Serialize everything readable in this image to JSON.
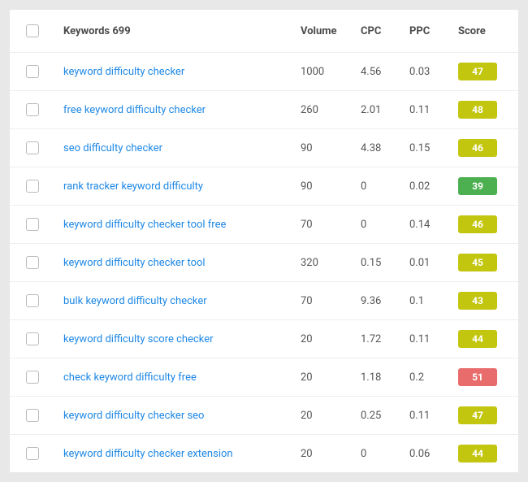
{
  "table": {
    "headers": {
      "keywords_label": "Keywords 699",
      "volume": "Volume",
      "cpc": "CPC",
      "ppc": "PPC",
      "score": "Score"
    },
    "rows": [
      {
        "keyword": "keyword difficulty checker",
        "volume": "1000",
        "cpc": "4.56",
        "ppc": "0.03",
        "score": "47",
        "score_class": "score-yellow"
      },
      {
        "keyword": "free keyword difficulty checker",
        "volume": "260",
        "cpc": "2.01",
        "ppc": "0.11",
        "score": "48",
        "score_class": "score-yellow"
      },
      {
        "keyword": "seo difficulty checker",
        "volume": "90",
        "cpc": "4.38",
        "ppc": "0.15",
        "score": "46",
        "score_class": "score-yellow"
      },
      {
        "keyword": "rank tracker keyword difficulty",
        "volume": "90",
        "cpc": "0",
        "ppc": "0.02",
        "score": "39",
        "score_class": "score-green"
      },
      {
        "keyword": "keyword difficulty checker tool free",
        "volume": "70",
        "cpc": "0",
        "ppc": "0.14",
        "score": "46",
        "score_class": "score-yellow"
      },
      {
        "keyword": "keyword difficulty checker tool",
        "volume": "320",
        "cpc": "0.15",
        "ppc": "0.01",
        "score": "45",
        "score_class": "score-yellow"
      },
      {
        "keyword": "bulk keyword difficulty checker",
        "volume": "70",
        "cpc": "9.36",
        "ppc": "0.1",
        "score": "43",
        "score_class": "score-yellow"
      },
      {
        "keyword": "keyword difficulty score checker",
        "volume": "20",
        "cpc": "1.72",
        "ppc": "0.11",
        "score": "44",
        "score_class": "score-yellow"
      },
      {
        "keyword": "check keyword difficulty free",
        "volume": "20",
        "cpc": "1.18",
        "ppc": "0.2",
        "score": "51",
        "score_class": "score-red"
      },
      {
        "keyword": "keyword difficulty checker seo",
        "volume": "20",
        "cpc": "0.25",
        "ppc": "0.11",
        "score": "47",
        "score_class": "score-yellow"
      },
      {
        "keyword": "keyword difficulty checker extension",
        "volume": "20",
        "cpc": "0",
        "ppc": "0.06",
        "score": "44",
        "score_class": "score-yellow"
      }
    ]
  }
}
